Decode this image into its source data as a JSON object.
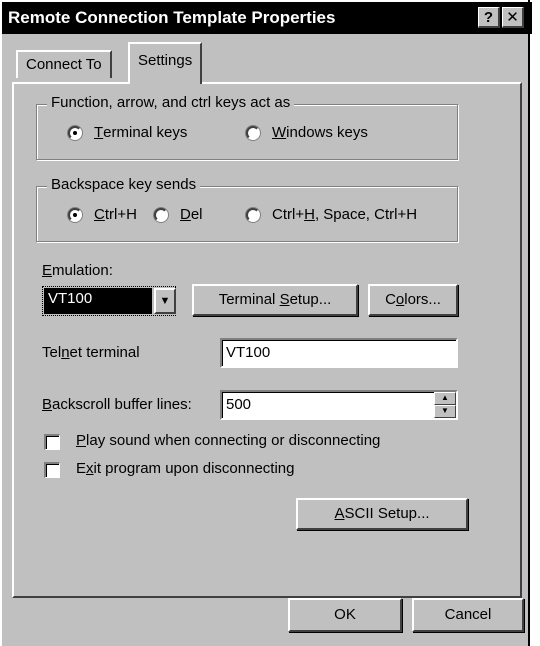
{
  "window": {
    "title": "Remote Connection Template Properties",
    "help_btn": "?",
    "close_btn": "✕"
  },
  "tabs": [
    {
      "label": "Connect To",
      "active": false
    },
    {
      "label": "Settings",
      "active": true
    }
  ],
  "function_keys": {
    "label": "Function, arrow, and ctrl keys act as",
    "options": [
      {
        "pre": "",
        "u": "T",
        "post": "erminal keys",
        "selected": true
      },
      {
        "pre": "",
        "u": "W",
        "post": "indows keys",
        "selected": false
      }
    ]
  },
  "backspace": {
    "label": "Backspace key sends",
    "options": [
      {
        "pre": "",
        "u": "C",
        "post": "trl+H",
        "selected": true
      },
      {
        "pre": "",
        "u": "D",
        "post": "el",
        "selected": false
      },
      {
        "pre": "Ctrl+",
        "u": "H",
        "post": ", Space, Ctrl+H",
        "selected": false
      }
    ]
  },
  "emulation": {
    "label_u": "E",
    "label_rest": "mulation:",
    "value": "VT100",
    "terminal_setup_pre": "Terminal ",
    "terminal_setup_u": "S",
    "terminal_setup_post": "etup...",
    "colors_pre": "C",
    "colors_u": "o",
    "colors_post": "lors..."
  },
  "telnet": {
    "label_pre": "Tel",
    "label_u": "n",
    "label_post": "et terminal",
    "value": "VT100"
  },
  "backscroll": {
    "label_u": "B",
    "label_rest": "ackscroll buffer lines:",
    "value": "500"
  },
  "checkboxes": [
    {
      "u": "P",
      "post": "lay sound when connecting or disconnecting",
      "pre": "",
      "checked": false
    },
    {
      "pre": "E",
      "u": "x",
      "post": "it program upon disconnecting",
      "checked": false
    }
  ],
  "ascii_setup": {
    "u": "A",
    "post": "SCII Setup..."
  },
  "footer": {
    "ok": "OK",
    "cancel": "Cancel"
  }
}
